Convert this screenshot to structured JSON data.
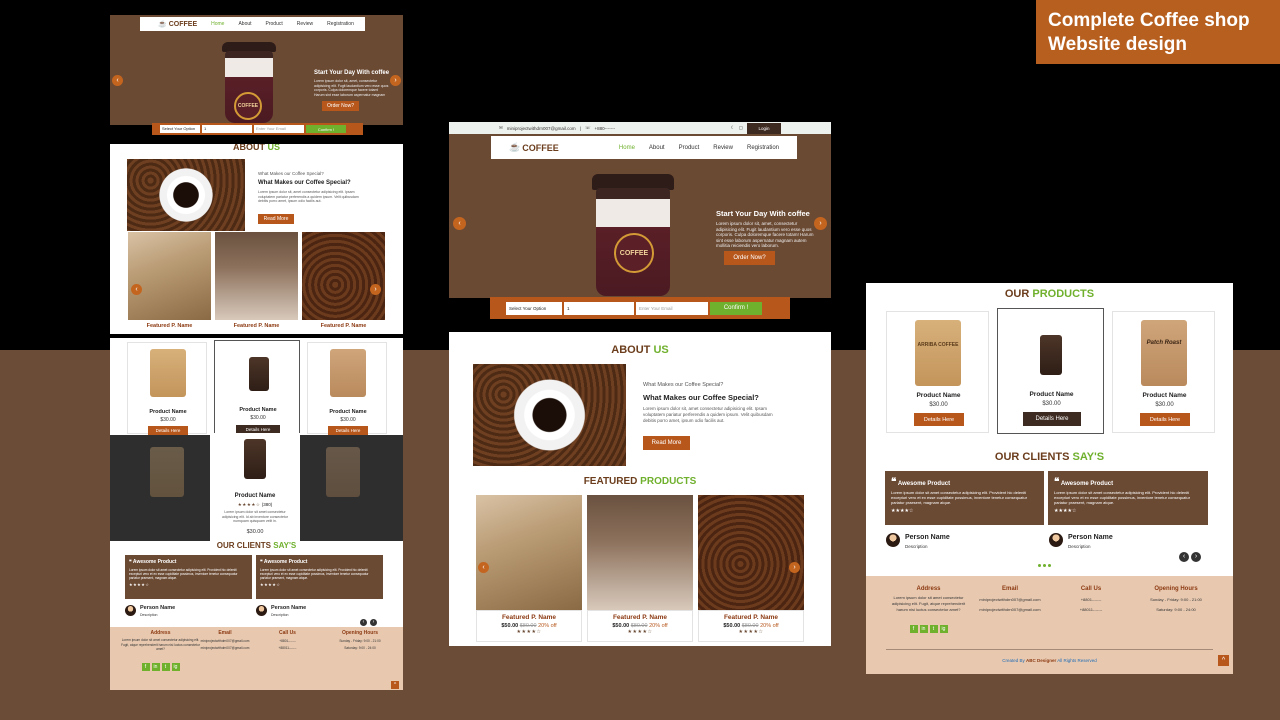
{
  "tag": {
    "line1": "Complete Coffee shop",
    "line2": "Website design"
  },
  "nav": {
    "logo": "COFFEE",
    "items": [
      "Home",
      "About",
      "Product",
      "Review",
      "Registration"
    ]
  },
  "topbar": {
    "email": "miniprojectwithdrn007@gmail.com",
    "phone": "+880-------",
    "login": "Login"
  },
  "hero": {
    "title": "Start Your Day With coffee",
    "text": "Lorem ipsum dolor sit, amet, consectetur adipisicing elit. Fugit laudantium vero esse quos corporis. Culpa doloremque facere totam! Harum sint esse laborum aspernatur magnam autem mollitia reiciendis vero laborum.",
    "button": "Order Now?",
    "cup_label": "COFFEE"
  },
  "search": {
    "select": "Select Your Option",
    "value": "1",
    "placeholder": "Enter Your Email",
    "button": "Confirm !"
  },
  "about": {
    "title_a": "ABOUT",
    "title_b": "US",
    "kicker": "What Makes our Coffee Special?",
    "heading": "What Makes our Coffee Special?",
    "text": "Lorem ipsum dolor sit, amet consectetur adipisicing elit. Ipsam voluptatem pariatur perferendis a quidem ipsum. Velit quibusdam debitis porro amet, ipsum odio facilis aut.",
    "button": "Read More"
  },
  "featured": {
    "title_a": "FEATURED",
    "title_b": "PRODUCTS",
    "items": [
      {
        "name": "Featured P. Name",
        "price": "$50.00",
        "old": "$80.00",
        "off": "20% off"
      },
      {
        "name": "Featured P. Name",
        "price": "$50.00",
        "old": "$80.00",
        "off": "20% off"
      },
      {
        "name": "Featured P. Name",
        "price": "$50.00",
        "old": "$80.00",
        "off": "20% off"
      }
    ]
  },
  "products": {
    "title_a": "OUR",
    "title_b": "PRODUCTS",
    "items": [
      {
        "name": "Product Name",
        "price": "$30.00",
        "button": "Details Here",
        "label": "ARRIBA COFFEE"
      },
      {
        "name": "Product Name",
        "price": "$30.00",
        "button": "Details Here",
        "label": ""
      },
      {
        "name": "Product Name",
        "price": "$30.00",
        "button": "Details Here",
        "label": "Patch Roast"
      }
    ]
  },
  "modal": {
    "name": "Product Name",
    "rating": "(380)",
    "text": "Lorem ipsum dolor sit amet consectetur adipisicing elit. Id ab inventore consectetur numquam quisquam velit in.",
    "price": "$30.00"
  },
  "clients": {
    "title_a": "OUR CLIENTS",
    "title_b": "SAY'S",
    "items": [
      {
        "title": "Awesome Product",
        "text": "Lorem ipsum dolor sit amet consectetur adipisicing elit. Provident hic deleniti excepturi vero et ex esse cupiditate possimus, inventore tenetur consequatur pariatur praesent, magnam atque.",
        "person": "Person Name",
        "role": "Description"
      },
      {
        "title": "Awesome Product",
        "text": "Lorem ipsum dolor sit amet consectetur adipisicing elit. Provident hic deleniti excepturi vero et ex esse cupiditate possimus, inventore tenetur consequatur pariatur praesent, magnam atque.",
        "person": "Person Name",
        "role": "Description"
      }
    ]
  },
  "footer": {
    "address_title": "Address",
    "address": "Lorem ipsum dolor sit amet consectetur adipisicing elit. Fugit, atque reprehenderit harum nisi luctus consectetur amet?",
    "email_title": "Email",
    "email1": "miniprojectwithdrn007@gmail.com",
    "email2": "miniprojectwithdrn007@gmail.com",
    "call_title": "Call Us",
    "call1": "+8801-------",
    "call2": "+88011-------",
    "hours_title": "Opening Hours",
    "hours1": "Sunday - Friday: 9:00 - 21:00",
    "hours2": "Saturday: 9:00 - 24:00",
    "credit_a": "Created By",
    "credit_b": "ABC Designer",
    "credit_c": "All Rights Reserved",
    "social": [
      "f",
      "in",
      "t",
      "ig"
    ]
  }
}
